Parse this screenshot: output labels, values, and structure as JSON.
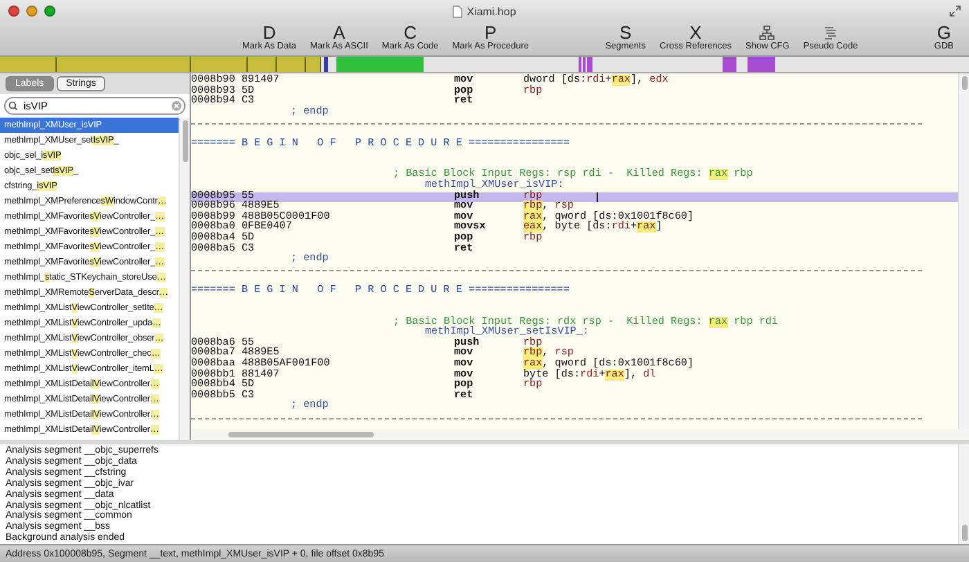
{
  "window": {
    "title": "Xiami.hop"
  },
  "toolbar": [
    {
      "kind": "letter",
      "glyph": "D",
      "label": "Mark As Data"
    },
    {
      "kind": "letter",
      "glyph": "A",
      "label": "Mark As ASCII"
    },
    {
      "kind": "letter",
      "glyph": "C",
      "label": "Mark As Code"
    },
    {
      "kind": "letter",
      "glyph": "P",
      "label": "Mark As Procedure"
    },
    {
      "kind": "spacer"
    },
    {
      "kind": "letter",
      "glyph": "S",
      "label": "Segments"
    },
    {
      "kind": "letter",
      "glyph": "X",
      "label": "Cross References"
    },
    {
      "kind": "graph",
      "label": "Show CFG"
    },
    {
      "kind": "listing",
      "label": "Pseudo Code"
    },
    {
      "kind": "spacer"
    },
    {
      "kind": "letter",
      "glyph": "G",
      "label": "GDB"
    }
  ],
  "sidebar": {
    "tabs": [
      {
        "label": "Labels",
        "selected": true
      },
      {
        "label": "Strings",
        "selected": false
      }
    ],
    "search": {
      "value": "isVIP"
    },
    "items": [
      {
        "parts": [
          "methImpl_XMUser_",
          "isVIP"
        ],
        "selected": true
      },
      {
        "parts": [
          "methImpl_XMUser_set",
          "IsVIP",
          "_"
        ],
        "selected": false
      },
      {
        "parts": [
          "objc_sel_",
          "isVIP"
        ],
        "selected": false
      },
      {
        "parts": [
          "objc_sel_set",
          "IsVIP",
          "_"
        ],
        "selected": false
      },
      {
        "parts": [
          "cfstring_",
          "isVIP"
        ],
        "selected": false
      },
      {
        "parts": [
          "methImpl_XMPreference",
          "sW",
          "indowContr",
          "…"
        ],
        "selected": false
      },
      {
        "parts": [
          "methImpl_XMFavorite",
          "sV",
          "iewController_",
          "…"
        ],
        "selected": false
      },
      {
        "parts": [
          "methImpl_XMFavorite",
          "sV",
          "iewController_",
          "…"
        ],
        "selected": false
      },
      {
        "parts": [
          "methImpl_XMFavorite",
          "sV",
          "iewController_",
          "…"
        ],
        "selected": false
      },
      {
        "parts": [
          "methImpl_XMFavorite",
          "sV",
          "iewController_",
          "…"
        ],
        "selected": false
      },
      {
        "parts": [
          "methImpl_",
          "s",
          "tatic_STKeychain_storeUse",
          "…"
        ],
        "selected": false
      },
      {
        "parts": [
          "methImpl_XMRemote",
          "S",
          "erverData_descr",
          "…"
        ],
        "selected": false
      },
      {
        "parts": [
          "methImpl_XMList",
          "V",
          "iewController_setIte",
          "…"
        ],
        "selected": false
      },
      {
        "parts": [
          "methImpl_XMList",
          "V",
          "iewController_upda",
          "…"
        ],
        "selected": false
      },
      {
        "parts": [
          "methImpl_XMList",
          "V",
          "iewController_obser",
          "…"
        ],
        "selected": false
      },
      {
        "parts": [
          "methImpl_XMList",
          "V",
          "iewController_chec",
          "…"
        ],
        "selected": false
      },
      {
        "parts": [
          "methImpl_XMList",
          "V",
          "iewController_itemL",
          "…"
        ],
        "selected": false
      },
      {
        "parts": [
          "methImpl_XMListDetai",
          "lV",
          "iewController",
          "…"
        ],
        "selected": false
      },
      {
        "parts": [
          "methImpl_XMListDetai",
          "lV",
          "iewController",
          "…"
        ],
        "selected": false
      },
      {
        "parts": [
          "methImpl_XMListDetai",
          "lV",
          "iewController",
          "…"
        ],
        "selected": false
      },
      {
        "parts": [
          "methImpl_XMListDetai",
          "lV",
          "iewController",
          "…"
        ],
        "selected": false
      }
    ]
  },
  "listing": [
    {
      "kind": "insn",
      "address": "0008b90",
      "bytes": "891407",
      "mnemonic": "mov",
      "operands": [
        {
          "text": "dword [ds:",
          "kind": "plain"
        },
        {
          "text": "rdi",
          "kind": "reg"
        },
        {
          "text": "+",
          "kind": "plain"
        },
        {
          "text": "rax",
          "kind": "marked"
        },
        {
          "text": "], ",
          "kind": "plain"
        },
        {
          "text": "edx",
          "kind": "reg"
        }
      ],
      "selected": false
    },
    {
      "kind": "insn",
      "address": "0008b93",
      "bytes": "5D",
      "mnemonic": "pop",
      "operands": [
        {
          "text": "rbp",
          "kind": "reg"
        }
      ],
      "selected": false
    },
    {
      "kind": "insn",
      "address": "0008b94",
      "bytes": "C3",
      "mnemonic": "ret",
      "selected": false
    },
    {
      "kind": "endp",
      "text": "; endp"
    },
    {
      "kind": "rule"
    },
    {
      "kind": "blank"
    },
    {
      "kind": "begin",
      "text": "======= B E G I N   O F   P R O C E D U R E ================"
    },
    {
      "kind": "blank"
    },
    {
      "kind": "blank"
    },
    {
      "kind": "comment",
      "parts": [
        {
          "text": "; Basic Block Input Regs: rsp rdi -  Killed Regs: ",
          "kind": "plain"
        },
        {
          "text": "rax",
          "kind": "marked"
        },
        {
          "text": " rbp",
          "kind": "plain"
        }
      ]
    },
    {
      "kind": "label",
      "text": "methImpl_XMUser_isVIP:"
    },
    {
      "kind": "insn",
      "address": "0008b95",
      "bytes": "55",
      "mnemonic": "push",
      "operands": [
        {
          "text": "rbp",
          "kind": "reg"
        }
      ],
      "selected": true
    },
    {
      "kind": "insn",
      "address": "0008b96",
      "bytes": "4889E5",
      "mnemonic": "mov",
      "operands": [
        {
          "text": "rbp",
          "kind": "marked"
        },
        {
          "text": ", ",
          "kind": "plain"
        },
        {
          "text": "rsp",
          "kind": "reg"
        }
      ],
      "selected": false
    },
    {
      "kind": "insn",
      "address": "0008b99",
      "bytes": "488B05C0001F00",
      "mnemonic": "mov",
      "operands": [
        {
          "text": "rax",
          "kind": "marked"
        },
        {
          "text": ", qword [ds:0x1001f8c60]",
          "kind": "plain"
        }
      ],
      "selected": false
    },
    {
      "kind": "insn",
      "address": "0008ba0",
      "bytes": "0FBE0407",
      "mnemonic": "movsx",
      "operands": [
        {
          "text": "eax",
          "kind": "marked"
        },
        {
          "text": ", byte [ds:",
          "kind": "plain"
        },
        {
          "text": "rdi",
          "kind": "reg"
        },
        {
          "text": "+",
          "kind": "plain"
        },
        {
          "text": "rax",
          "kind": "marked"
        },
        {
          "text": "]",
          "kind": "plain"
        }
      ],
      "selected": false
    },
    {
      "kind": "insn",
      "address": "0008ba4",
      "bytes": "5D",
      "mnemonic": "pop",
      "operands": [
        {
          "text": "rbp",
          "kind": "reg"
        }
      ],
      "selected": false
    },
    {
      "kind": "insn",
      "address": "0008ba5",
      "bytes": "C3",
      "mnemonic": "ret",
      "selected": false
    },
    {
      "kind": "endp",
      "text": "; endp"
    },
    {
      "kind": "rule"
    },
    {
      "kind": "blank"
    },
    {
      "kind": "begin",
      "text": "======= B E G I N   O F   P R O C E D U R E ================"
    },
    {
      "kind": "blank"
    },
    {
      "kind": "blank"
    },
    {
      "kind": "comment",
      "parts": [
        {
          "text": "; Basic Block Input Regs: rdx rsp -  Killed Regs: ",
          "kind": "plain"
        },
        {
          "text": "rax",
          "kind": "marked"
        },
        {
          "text": " rbp rdi",
          "kind": "plain"
        }
      ]
    },
    {
      "kind": "label",
      "text": "methImpl_XMUser_setIsVIP_:"
    },
    {
      "kind": "insn",
      "address": "0008ba6",
      "bytes": "55",
      "mnemonic": "push",
      "operands": [
        {
          "text": "rbp",
          "kind": "reg"
        }
      ],
      "selected": false
    },
    {
      "kind": "insn",
      "address": "0008ba7",
      "bytes": "4889E5",
      "mnemonic": "mov",
      "operands": [
        {
          "text": "rbp",
          "kind": "marked"
        },
        {
          "text": ", ",
          "kind": "plain"
        },
        {
          "text": "rsp",
          "kind": "reg"
        }
      ],
      "selected": false
    },
    {
      "kind": "insn",
      "address": "0008baa",
      "bytes": "488B05AF001F00",
      "mnemonic": "mov",
      "operands": [
        {
          "text": "rax",
          "kind": "marked"
        },
        {
          "text": ", qword [ds:0x1001f8c60]",
          "kind": "plain"
        }
      ],
      "selected": false
    },
    {
      "kind": "insn",
      "address": "0008bb1",
      "bytes": "881407",
      "mnemonic": "mov",
      "operands": [
        {
          "text": "byte [ds:",
          "kind": "plain"
        },
        {
          "text": "rdi",
          "kind": "reg"
        },
        {
          "text": "+",
          "kind": "plain"
        },
        {
          "text": "rax",
          "kind": "marked"
        },
        {
          "text": "], ",
          "kind": "plain"
        },
        {
          "text": "dl",
          "kind": "reg"
        }
      ],
      "selected": false
    },
    {
      "kind": "insn",
      "address": "0008bb4",
      "bytes": "5D",
      "mnemonic": "pop",
      "operands": [
        {
          "text": "rbp",
          "kind": "reg"
        }
      ],
      "selected": false
    },
    {
      "kind": "insn",
      "address": "0008bb5",
      "bytes": "C3",
      "mnemonic": "ret",
      "selected": false
    },
    {
      "kind": "endp",
      "text": "; endp"
    },
    {
      "kind": "rule"
    }
  ],
  "log": [
    "Analysis segment __objc_superrefs",
    "Analysis segment __objc_data",
    "Analysis segment __cfstring",
    "Analysis segment __objc_ivar",
    "Analysis segment __data",
    "Analysis segment __objc_nlcatlist",
    "Analysis segment __common",
    "Analysis segment __bss",
    "Background analysis ended"
  ],
  "status_bar": "Address 0x100008b95, Segment __text, methImpl_XMUser_isVIP + 0, file offset 0x8b95"
}
